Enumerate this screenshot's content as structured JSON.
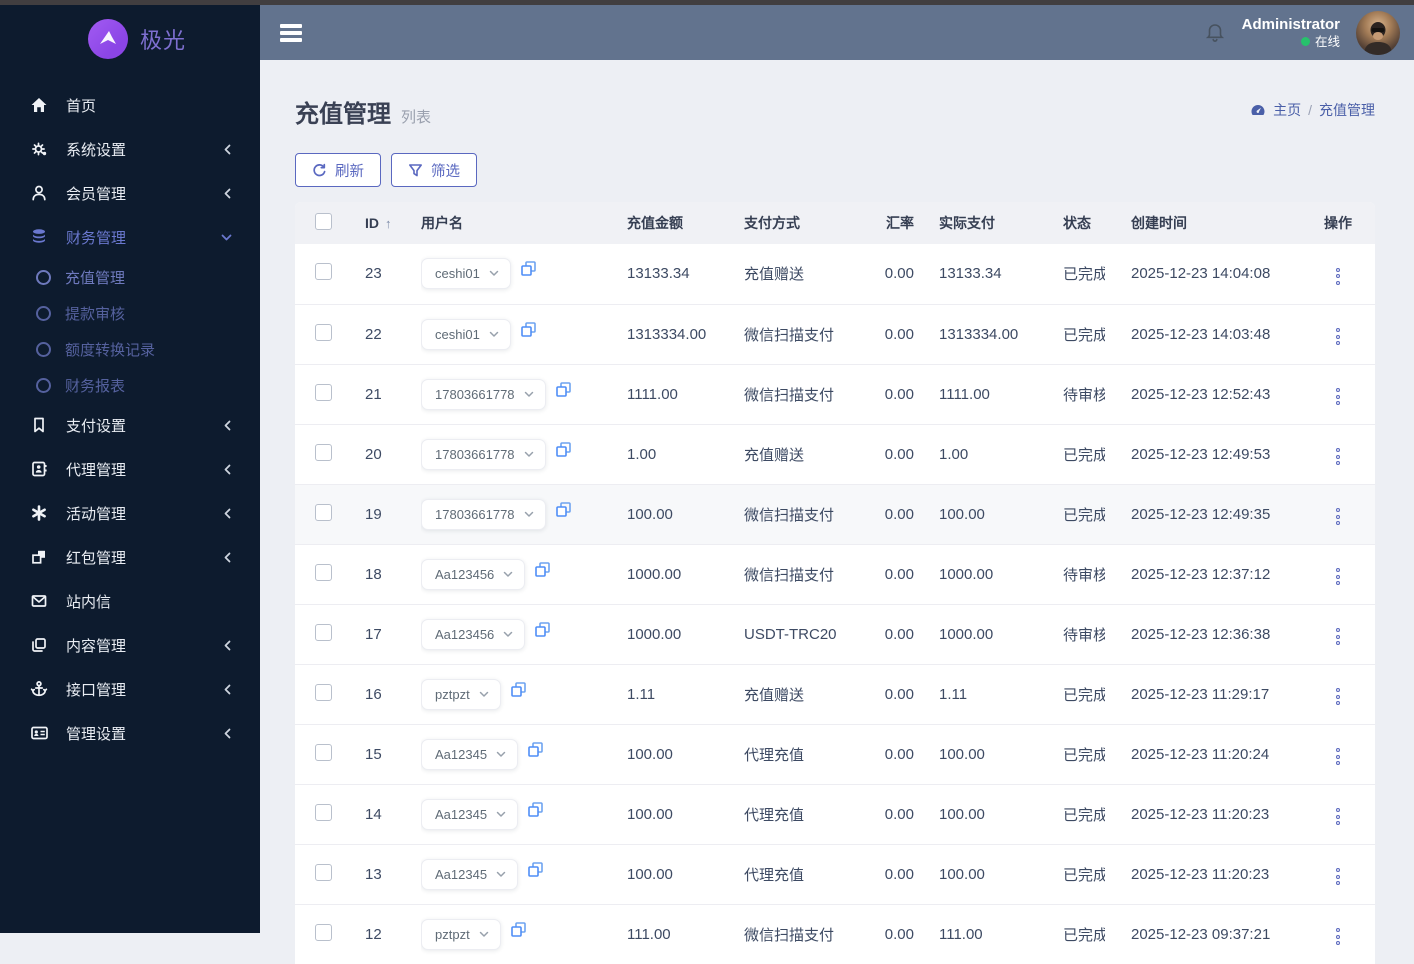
{
  "colors": {
    "accent": "#5a68c0",
    "sidebar_bg": "#0d1b2e",
    "topbar_bg": "#62738e",
    "active_menu": "#6a78cf",
    "online_green": "#27c26c",
    "copy_blue": "#4f8ef7"
  },
  "topbar": {
    "user": "Administrator",
    "status": "在线",
    "icons": [
      "hamburger-icon",
      "bell-icon",
      "avatar"
    ]
  },
  "sidebar": {
    "logo_text": "极光",
    "items": [
      {
        "icon": "home-icon",
        "label": "首页"
      },
      {
        "icon": "gears-icon",
        "label": "系统设置",
        "chevron": "left"
      },
      {
        "icon": "user-icon",
        "label": "会员管理",
        "chevron": "left"
      },
      {
        "icon": "database-icon",
        "label": "财务管理",
        "chevron": "down",
        "active": true,
        "children": [
          {
            "label": "充值管理",
            "active": true
          },
          {
            "label": "提款审核"
          },
          {
            "label": "额度转换记录"
          },
          {
            "label": "财务报表"
          }
        ]
      },
      {
        "icon": "bookmark-icon",
        "label": "支付设置",
        "chevron": "left"
      },
      {
        "icon": "address-book-icon",
        "label": "代理管理",
        "chevron": "left"
      },
      {
        "icon": "asterisk-icon",
        "label": "活动管理",
        "chevron": "left"
      },
      {
        "icon": "cubes-icon",
        "label": "红包管理",
        "chevron": "left"
      },
      {
        "icon": "envelope-icon",
        "label": "站内信"
      },
      {
        "icon": "clone-icon",
        "label": "内容管理",
        "chevron": "left"
      },
      {
        "icon": "anchor-icon",
        "label": "接口管理",
        "chevron": "left"
      },
      {
        "icon": "id-card-icon",
        "label": "管理设置",
        "chevron": "left"
      }
    ]
  },
  "page": {
    "title": "充值管理",
    "subtitle": "列表",
    "breadcrumb": {
      "icon": "dashboard-icon",
      "home": "主页",
      "sep": "/",
      "current": "充值管理"
    }
  },
  "toolbar": {
    "refresh_label": "刷新",
    "filter_label": "筛选"
  },
  "table": {
    "headers": [
      "ID",
      "用户名",
      "充值金额",
      "支付方式",
      "汇率",
      "实际支付",
      "状态",
      "创建时间",
      "操作"
    ],
    "sort": {
      "column": "ID",
      "direction": "asc"
    },
    "rows": [
      {
        "id": "23",
        "username": "ceshi01",
        "amount": "13133.34",
        "method": "充值赠送",
        "rate": "0.00",
        "actual": "13133.34",
        "status": "已完成",
        "time": "2025-12-23 14:04:08"
      },
      {
        "id": "22",
        "username": "ceshi01",
        "amount": "1313334.00",
        "method": "微信扫描支付",
        "rate": "0.00",
        "actual": "1313334.00",
        "status": "已完成",
        "time": "2025-12-23 14:03:48"
      },
      {
        "id": "21",
        "username": "17803661778",
        "amount": "1111.00",
        "method": "微信扫描支付",
        "rate": "0.00",
        "actual": "1111.00",
        "status": "待审核",
        "time": "2025-12-23 12:52:43"
      },
      {
        "id": "20",
        "username": "17803661778",
        "amount": "1.00",
        "method": "充值赠送",
        "rate": "0.00",
        "actual": "1.00",
        "status": "已完成",
        "time": "2025-12-23 12:49:53"
      },
      {
        "id": "19",
        "username": "17803661778",
        "amount": "100.00",
        "method": "微信扫描支付",
        "rate": "0.00",
        "actual": "100.00",
        "status": "已完成",
        "time": "2025-12-23 12:49:35",
        "highlighted": true
      },
      {
        "id": "18",
        "username": "Aa123456",
        "amount": "1000.00",
        "method": "微信扫描支付",
        "rate": "0.00",
        "actual": "1000.00",
        "status": "待审核",
        "time": "2025-12-23 12:37:12"
      },
      {
        "id": "17",
        "username": "Aa123456",
        "amount": "1000.00",
        "method": "USDT-TRC20",
        "rate": "0.00",
        "actual": "1000.00",
        "status": "待审核",
        "time": "2025-12-23 12:36:38"
      },
      {
        "id": "16",
        "username": "pztpzt",
        "amount": "1.11",
        "method": "充值赠送",
        "rate": "0.00",
        "actual": "1.11",
        "status": "已完成",
        "time": "2025-12-23 11:29:17"
      },
      {
        "id": "15",
        "username": "Aa12345",
        "amount": "100.00",
        "method": "代理充值",
        "rate": "0.00",
        "actual": "100.00",
        "status": "已完成",
        "time": "2025-12-23 11:20:24"
      },
      {
        "id": "14",
        "username": "Aa12345",
        "amount": "100.00",
        "method": "代理充值",
        "rate": "0.00",
        "actual": "100.00",
        "status": "已完成",
        "time": "2025-12-23 11:20:23"
      },
      {
        "id": "13",
        "username": "Aa12345",
        "amount": "100.00",
        "method": "代理充值",
        "rate": "0.00",
        "actual": "100.00",
        "status": "已完成",
        "time": "2025-12-23 11:20:23"
      },
      {
        "id": "12",
        "username": "pztpzt",
        "amount": "111.00",
        "method": "微信扫描支付",
        "rate": "0.00",
        "actual": "111.00",
        "status": "已完成",
        "time": "2025-12-23 09:37:21"
      }
    ]
  }
}
